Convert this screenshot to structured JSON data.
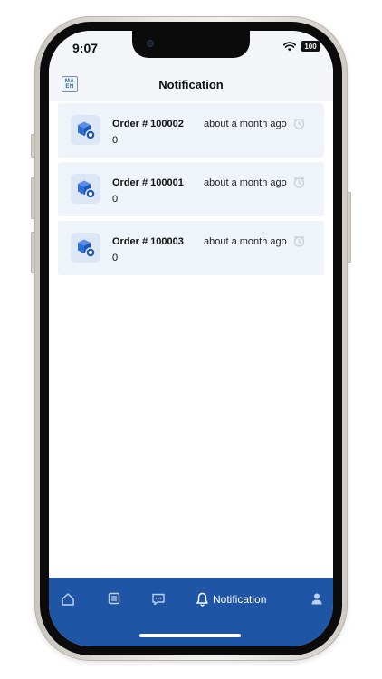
{
  "status_bar": {
    "time": "9:07",
    "battery": "100"
  },
  "header": {
    "title": "Notification",
    "logo_top": "MA",
    "logo_bottom": "EN"
  },
  "notifications": [
    {
      "title": "Order # 100002",
      "subtitle": "0",
      "time": "about a month ago"
    },
    {
      "title": "Order # 100001",
      "subtitle": "0",
      "time": "about a month ago"
    },
    {
      "title": "Order # 100003",
      "subtitle": "0",
      "time": "about a month ago"
    }
  ],
  "bottom_nav": {
    "active_label": "Notification"
  },
  "colors": {
    "accent": "#1f55a5",
    "card_bg": "#eff3fa",
    "icon_blue": "#2f6fd6"
  }
}
